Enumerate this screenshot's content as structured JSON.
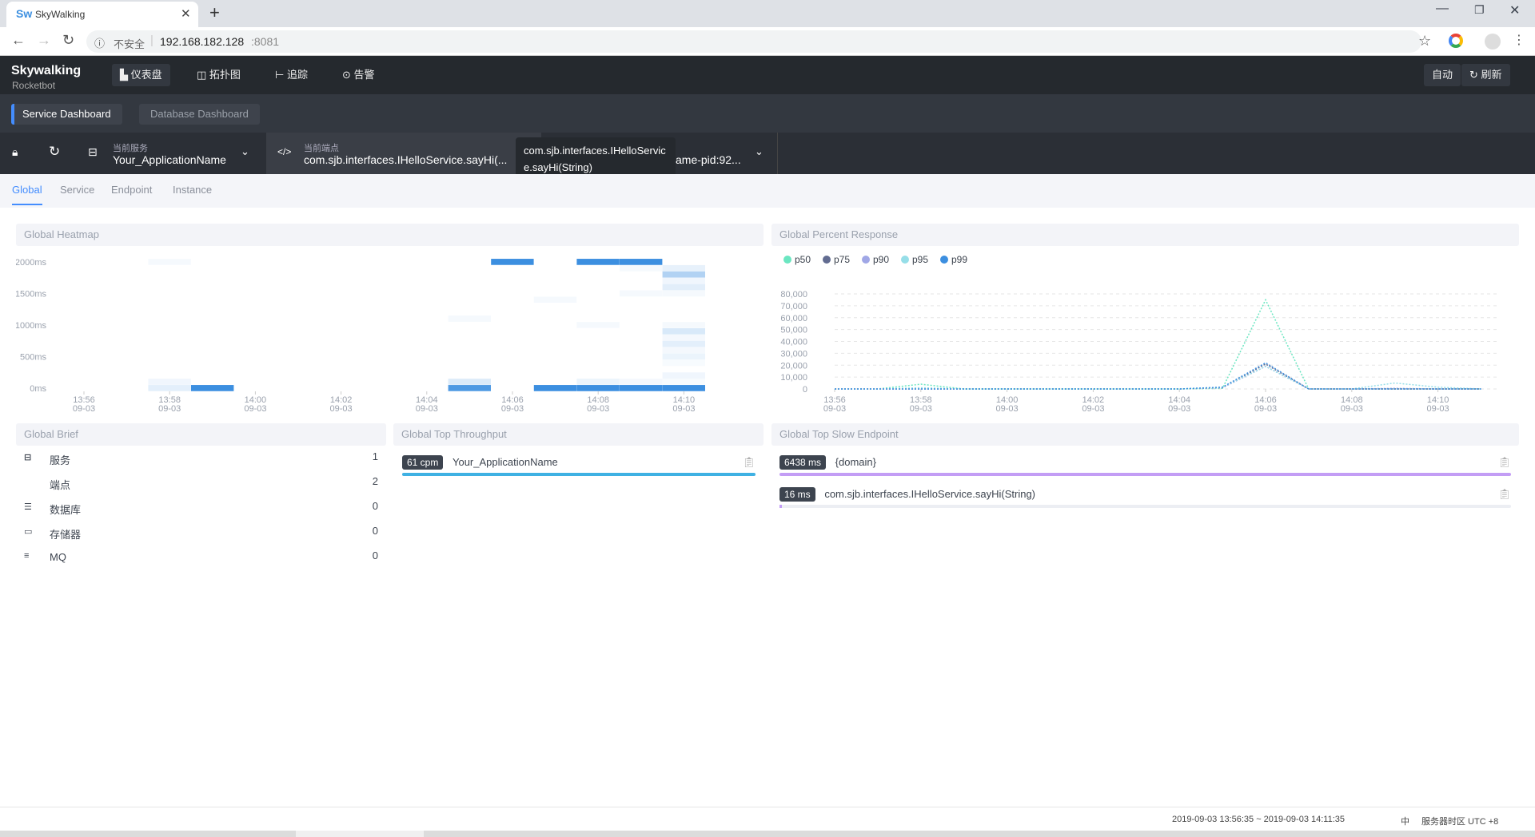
{
  "browser": {
    "tab_title": "SkyWalking",
    "url_host": "192.168.182.128",
    "url_port": ":8081",
    "security_label": "不安全"
  },
  "app": {
    "logo_top": "Skywalking",
    "logo_bottom": "Rocketbot",
    "nav": [
      {
        "label": "仪表盘",
        "icon": "chart-icon"
      },
      {
        "label": "拓扑图",
        "icon": "topology-icon"
      },
      {
        "label": "追踪",
        "icon": "trace-icon"
      },
      {
        "label": "告警",
        "icon": "alarm-icon"
      }
    ],
    "auto_label": "自动",
    "refresh_label": "刷新"
  },
  "dashboards": [
    "Service Dashboard",
    "Database Dashboard"
  ],
  "selectors": {
    "service_caption": "当前服务",
    "service_value": "Your_ApplicationName",
    "endpoint_caption": "当前端点",
    "endpoint_value": "com.sjb.interfaces.IHelloService.sayHi(...",
    "instance_value": "ame-pid:92...",
    "tooltip": "com.sjb.interfaces.IHelloService.sayHi(String)"
  },
  "subtabs": [
    "Global",
    "Service",
    "Endpoint",
    "Instance"
  ],
  "cards": {
    "heatmap": "Global Heatmap",
    "percent": "Global Percent Response",
    "brief": "Global Brief",
    "throughput": "Global Top Throughput",
    "slow": "Global Top Slow Endpoint"
  },
  "brief": [
    {
      "label": "服务",
      "value": "1",
      "icon": "service-icon"
    },
    {
      "label": "端点",
      "value": "2",
      "icon": "code-icon"
    },
    {
      "label": "数据库",
      "value": "0",
      "icon": "database-icon"
    },
    {
      "label": "存储器",
      "value": "0",
      "icon": "cache-icon"
    },
    {
      "label": "MQ",
      "value": "0",
      "icon": "mq-icon"
    }
  ],
  "throughput": [
    {
      "badge": "61 cpm",
      "name": "Your_ApplicationName",
      "fill": 1.0,
      "color": "#3fb1e3"
    }
  ],
  "slow": [
    {
      "badge": "6438 ms",
      "name": "{domain}",
      "fill": 1.0,
      "color": "#c39df5"
    },
    {
      "badge": "16 ms",
      "name": "com.sjb.interfaces.IHelloService.sayHi(String)",
      "fill": 0.003,
      "color": "#c39df5"
    }
  ],
  "footer": {
    "range": "2019-09-03 13:56:35 ~ 2019-09-03 14:11:35",
    "lang": "中",
    "timezone": "服务器时区 UTC +8"
  },
  "chart_data": [
    {
      "type": "heatmap",
      "title": "Global Heatmap",
      "x_ticks": [
        "13:56\n09-03",
        "13:58\n09-03",
        "14:00\n09-03",
        "14:02\n09-03",
        "14:04\n09-03",
        "14:06\n09-03",
        "14:08\n09-03",
        "14:10\n09-03"
      ],
      "x_minutes": [
        "13:56",
        "13:57",
        "13:58",
        "13:59",
        "14:00",
        "14:01",
        "14:02",
        "14:03",
        "14:04",
        "14:05",
        "14:06",
        "14:07",
        "14:08",
        "14:09",
        "14:10"
      ],
      "y_ticks": [
        "2000ms",
        "1500ms",
        "1000ms",
        "500ms",
        "0ms"
      ],
      "ylim": [
        0,
        2000
      ],
      "bucket_ms": 100,
      "cells": [
        [
          "13:58",
          2000,
          0.05
        ],
        [
          "13:58",
          100,
          0.08
        ],
        [
          "13:58",
          0,
          0.14
        ],
        [
          "13:59",
          0,
          1
        ],
        [
          "14:05",
          1100,
          0.05
        ],
        [
          "14:05",
          100,
          0.18
        ],
        [
          "14:05",
          0,
          0.9
        ],
        [
          "14:06",
          2000,
          1
        ],
        [
          "14:07",
          1400,
          0.05
        ],
        [
          "14:07",
          0,
          1
        ],
        [
          "14:08",
          2000,
          1
        ],
        [
          "14:08",
          1000,
          0.05
        ],
        [
          "14:08",
          100,
          0.1
        ],
        [
          "14:08",
          0,
          1
        ],
        [
          "14:09",
          2000,
          1
        ],
        [
          "14:09",
          1900,
          0.05
        ],
        [
          "14:09",
          1500,
          0.05
        ],
        [
          "14:09",
          100,
          0.06
        ],
        [
          "14:09",
          0,
          1
        ],
        [
          "14:10",
          1900,
          0.12
        ],
        [
          "14:10",
          1800,
          0.4
        ],
        [
          "14:10",
          1700,
          0.08
        ],
        [
          "14:10",
          1600,
          0.15
        ],
        [
          "14:10",
          1500,
          0.05
        ],
        [
          "14:10",
          1000,
          0.05
        ],
        [
          "14:10",
          900,
          0.2
        ],
        [
          "14:10",
          800,
          0.06
        ],
        [
          "14:10",
          700,
          0.14
        ],
        [
          "14:10",
          600,
          0.06
        ],
        [
          "14:10",
          500,
          0.1
        ],
        [
          "14:10",
          400,
          0.04
        ],
        [
          "14:10",
          200,
          0.08
        ],
        [
          "14:10",
          100,
          0.04
        ],
        [
          "14:10",
          0,
          1
        ]
      ]
    },
    {
      "type": "line",
      "title": "Global Percent Response",
      "ylim": [
        0,
        80000
      ],
      "grid": true,
      "legend": "top-left",
      "y_ticks": [
        "80,000",
        "70,000",
        "60,000",
        "50,000",
        "40,000",
        "30,000",
        "20,000",
        "10,000",
        "0"
      ],
      "x": [
        "13:56",
        "13:57",
        "13:58",
        "13:59",
        "14:00",
        "14:01",
        "14:02",
        "14:03",
        "14:04",
        "14:05",
        "14:06",
        "14:07",
        "14:08",
        "14:09",
        "14:10",
        "14:11"
      ],
      "x_ticks": [
        "13:56\n09-03",
        "13:58\n09-03",
        "14:00\n09-03",
        "14:02\n09-03",
        "14:04\n09-03",
        "14:06\n09-03",
        "14:08\n09-03",
        "14:10\n09-03"
      ],
      "series": [
        {
          "name": "p50",
          "color": "#6be6c1",
          "values": [
            0,
            0,
            4000,
            0,
            0,
            0,
            0,
            0,
            0,
            500,
            75000,
            0,
            0,
            0,
            0,
            0
          ]
        },
        {
          "name": "p75",
          "color": "#626c91",
          "values": [
            0,
            0,
            0,
            0,
            0,
            0,
            0,
            0,
            0,
            1000,
            21000,
            0,
            0,
            0,
            0,
            0
          ]
        },
        {
          "name": "p90",
          "color": "#a0a7e6",
          "values": [
            0,
            0,
            0,
            0,
            0,
            0,
            0,
            0,
            0,
            1000,
            19000,
            0,
            0,
            500,
            0,
            0
          ]
        },
        {
          "name": "p95",
          "color": "#96dee8",
          "values": [
            0,
            0,
            1000,
            0,
            0,
            0,
            0,
            0,
            0,
            1500,
            19000,
            0,
            0,
            5000,
            1500,
            0
          ]
        },
        {
          "name": "p99",
          "color": "#3c8fe0",
          "values": [
            0,
            0,
            0,
            0,
            0,
            0,
            0,
            0,
            0,
            1500,
            22000,
            0,
            0,
            0,
            0,
            0
          ]
        }
      ]
    }
  ]
}
